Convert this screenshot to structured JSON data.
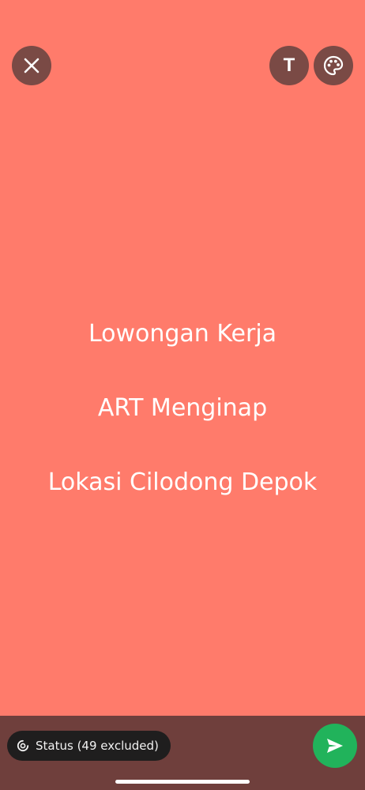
{
  "status_text": {
    "lines": [
      "Lowongan Kerja",
      "ART Menginap",
      "Lokasi Cilodong Depok"
    ]
  },
  "toolbar": {
    "close_icon": "close-icon",
    "text_button_label": "T",
    "palette_icon": "palette-icon"
  },
  "footer": {
    "audience_label": "Status (49 excluded)",
    "audience_icon": "status-ring-icon",
    "send_icon": "send-icon"
  },
  "colors": {
    "background": "#ff7b6b",
    "toolbar_button": "#7a4a45",
    "bottom_bar": "#6f3f3c",
    "chip": "#1f1e1e",
    "send": "#21b35b"
  }
}
